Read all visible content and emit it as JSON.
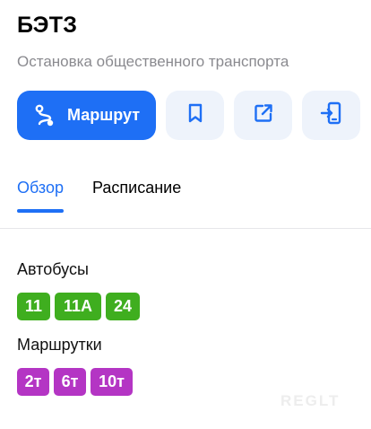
{
  "stop": {
    "title": "БЭТЗ",
    "subtitle": "Остановка общественного транспорта"
  },
  "actions": {
    "route_label": "Маршрут",
    "route_icon": "route-icon",
    "bookmark_icon": "bookmark-icon",
    "share_icon": "share-icon",
    "send_to_phone_icon": "send-to-phone-icon"
  },
  "tabs": [
    {
      "label": "Обзор",
      "active": true
    },
    {
      "label": "Расписание",
      "active": false
    }
  ],
  "transport": {
    "buses_label": "Автобусы",
    "buses": [
      "11",
      "11А",
      "24"
    ],
    "minibuses_label": "Маршрутки",
    "minibuses": [
      "2т",
      "6т",
      "10т"
    ]
  },
  "watermark": "REGLT",
  "colors": {
    "accent": "#1e6ff5",
    "bus": "#3fae1f",
    "minibus": "#b435c4",
    "action_bg": "#eef3fb"
  }
}
